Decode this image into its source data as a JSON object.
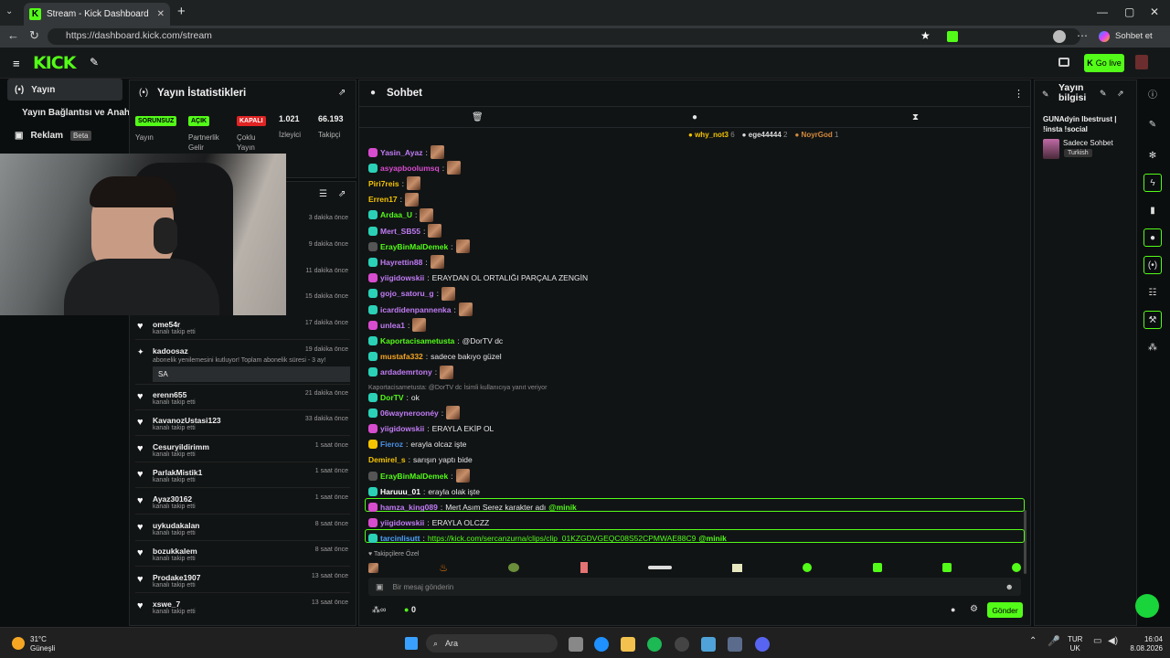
{
  "browser": {
    "tab_title": "Stream - Kick Dashboard",
    "url": "https://dashboard.kick.com/stream",
    "profile_label": "Sohbet et"
  },
  "kick": {
    "logo": "KICK",
    "go_live": "Go live"
  },
  "nav": {
    "items": [
      {
        "label": "Yayın",
        "icon": "broadcast-icon"
      },
      {
        "label": "Yayın Bağlantısı ve Anahtarı",
        "icon": "key-icon"
      },
      {
        "label": "Reklam",
        "icon": "ad-icon",
        "badge": "Beta"
      }
    ]
  },
  "stats": {
    "title": "Yayın İstatistikleri",
    "items": [
      {
        "status": "SORUNSUZ",
        "label": "Yayın",
        "color": "#53fc18"
      },
      {
        "status": "AÇIK",
        "label": "Partnerlik Gelir",
        "color": "#53fc18"
      },
      {
        "status": "KAPALI",
        "label": "Çoklu Yayın",
        "color": "#e02424"
      },
      {
        "value": "1.021",
        "label": "İzleyici"
      },
      {
        "value": "66.193",
        "label": "Takipçi"
      }
    ]
  },
  "activity": {
    "rows": [
      {
        "name": "",
        "sub": "",
        "time": "3 dakika önce"
      },
      {
        "name": "",
        "sub": "",
        "time": "9 dakika önce"
      },
      {
        "name": "",
        "sub": "",
        "time": "11 dakika önce"
      },
      {
        "name": "",
        "sub": "",
        "time": "15 dakika önce"
      },
      {
        "name": "ome54r",
        "sub": "kanalı takip etti",
        "time": "17 dakika önce"
      },
      {
        "name": "kadoosaz",
        "sub": "abonelik yenilemesini kutluyor! Toplam abonelik süresi - 3 ay!",
        "time": "19 dakika önce",
        "message": "SA"
      },
      {
        "name": "erenn655",
        "sub": "kanalı takip etti",
        "time": "21 dakika önce"
      },
      {
        "name": "KavanozUstasi123",
        "sub": "kanalı takip etti",
        "time": "33 dakika önce"
      },
      {
        "name": "Cesuryildirimm",
        "sub": "kanalı takip etti",
        "time": "1 saat önce"
      },
      {
        "name": "ParlakMistik1",
        "sub": "kanalı takip etti",
        "time": "1 saat önce"
      },
      {
        "name": "Ayaz30162",
        "sub": "kanalı takip etti",
        "time": "1 saat önce"
      },
      {
        "name": "uykudakalan",
        "sub": "kanalı takip etti",
        "time": "8 saat önce"
      },
      {
        "name": "bozukkalem",
        "sub": "kanalı takip etti",
        "time": "8 saat önce"
      },
      {
        "name": "Prodake1907",
        "sub": "kanalı takip etti",
        "time": "13 saat önce"
      },
      {
        "name": "xswe_7",
        "sub": "kanalı takip etti",
        "time": "13 saat önce"
      }
    ]
  },
  "chat": {
    "title": "Sohbet",
    "top_gifters": [
      {
        "name": "why_not3",
        "count": "6",
        "color": "#f5c400"
      },
      {
        "name": "ege44444",
        "count": "2",
        "color": "#dddddd"
      },
      {
        "name": "NoyrGod",
        "count": "1",
        "color": "#d58a3c"
      }
    ],
    "messages": [
      {
        "user": "Yasin_Ayaz",
        "color": "#c17cf5",
        "text": "",
        "emote": true,
        "badge": "#d84ccf"
      },
      {
        "user": "asyapboolumsq",
        "color": "#d84ccf",
        "text": "",
        "emote": true,
        "badge": "#2bd1b7"
      },
      {
        "user": "Piri7reis",
        "color": "#f5c400",
        "text": "",
        "emote": true,
        "badge": ""
      },
      {
        "user": "Erren17",
        "color": "#f5c400",
        "text": "",
        "emote": true,
        "badge": ""
      },
      {
        "user": "Ardaa_U",
        "color": "#53fc18",
        "text": "",
        "emote": true,
        "badge": "#2bd1b7"
      },
      {
        "user": "Mert_SB55",
        "color": "#c17cf5",
        "text": "",
        "emote": true,
        "badge": "#2bd1b7"
      },
      {
        "user": "ErayBinMalDemek",
        "color": "#53fc18",
        "text": "",
        "emote": true,
        "badge": "#555"
      },
      {
        "user": "Hayrettin88",
        "color": "#c17cf5",
        "text": "",
        "emote": true,
        "badge": "#2bd1b7"
      },
      {
        "user": "yiigidowskii",
        "color": "#c17cf5",
        "text": "ERAYDAN OL ORTALIĞI PARÇALA ZENGİN",
        "emote": false,
        "badge": "#d84ccf"
      },
      {
        "user": "gojo_satoru_g",
        "color": "#c17cf5",
        "text": "",
        "emote": true,
        "badge": "#2bd1b7"
      },
      {
        "user": "icardidenpannenka",
        "color": "#c17cf5",
        "text": "",
        "emote": true,
        "badge": "#2bd1b7"
      },
      {
        "user": "unlea1",
        "color": "#c17cf5",
        "text": "",
        "emote": true,
        "badge": "#d84ccf"
      },
      {
        "user": "Kaportacisametusta",
        "color": "#53fc18",
        "text": "@DorTV dc",
        "emote": false,
        "badge": "#2bd1b7"
      },
      {
        "user": "mustafa332",
        "color": "#f5a623",
        "text": "sadece bakıyo güzel",
        "emote": false,
        "badge": "#2bd1b7"
      },
      {
        "user": "ardademrtony",
        "color": "#c17cf5",
        "text": "",
        "emote": true,
        "badge": "#2bd1b7"
      },
      {
        "user": "DorTV",
        "color": "#53fc18",
        "text": "ok",
        "emote": false,
        "badge": "#2bd1b7",
        "reply": "Kaportacisametusta: @DorTV dc İsimli kullanıcıya yanıt veriyor"
      },
      {
        "user": "06wayneroonéy",
        "color": "#c17cf5",
        "text": "",
        "emote": true,
        "badge": "#2bd1b7"
      },
      {
        "user": "yiigidowskii",
        "color": "#c17cf5",
        "text": "ERAYLA EKİP OL",
        "emote": false,
        "badge": "#d84ccf"
      },
      {
        "user": "Fieroz",
        "color": "#4a90e2",
        "text": "erayla olcaz işte",
        "emote": false,
        "badge": "#f5c400"
      },
      {
        "user": "Demirel_s",
        "color": "#f5c400",
        "text": "sarışın yaptı bide",
        "emote": false,
        "badge": ""
      },
      {
        "user": "ErayBinMalDemek",
        "color": "#53fc18",
        "text": "",
        "emote": true,
        "badge": "#555"
      },
      {
        "user": "Haruuu_01",
        "color": "#ffffff",
        "text": "erayla olak işte",
        "emote": false,
        "badge": "#2bd1b7"
      },
      {
        "user": "hamza_king089",
        "color": "#c17cf5",
        "text": "Mert Asım Serez karakter adı ",
        "mention": "@minik",
        "emote": false,
        "badge": "#d84ccf",
        "highlight": true
      },
      {
        "user": "yiigidowskii",
        "color": "#c17cf5",
        "text": "ERAYLA OLCZZ",
        "emote": false,
        "badge": "#d84ccf"
      },
      {
        "user": "tarcinlisutt",
        "color": "#4aa3ff",
        "link": "https://kick.com/sercanzurna/clips/clip_01KZGDVGEQC08S52CPMWAE88C9",
        "mention": "@minik",
        "text": "",
        "emote": false,
        "badge": "#2bd1b7",
        "highlight": true
      }
    ],
    "emote_bar_label": "Takipçilere Özel",
    "input_placeholder": "Bir mesaj gönderin",
    "viewer_count": "0",
    "send_label": "Gönder"
  },
  "stream_info": {
    "title": "Yayın bilgisi",
    "stream_title": "GUNAdyin Ibestrust | !insta !social",
    "mode": "Sadece Sohbet",
    "language": "Turkish"
  },
  "taskbar": {
    "temp": "31°C",
    "weather": "Güneşli",
    "search": "Ara",
    "lang_top": "TUR",
    "lang_bottom": "UK",
    "time": "16:04",
    "date": "8.08.2026"
  }
}
